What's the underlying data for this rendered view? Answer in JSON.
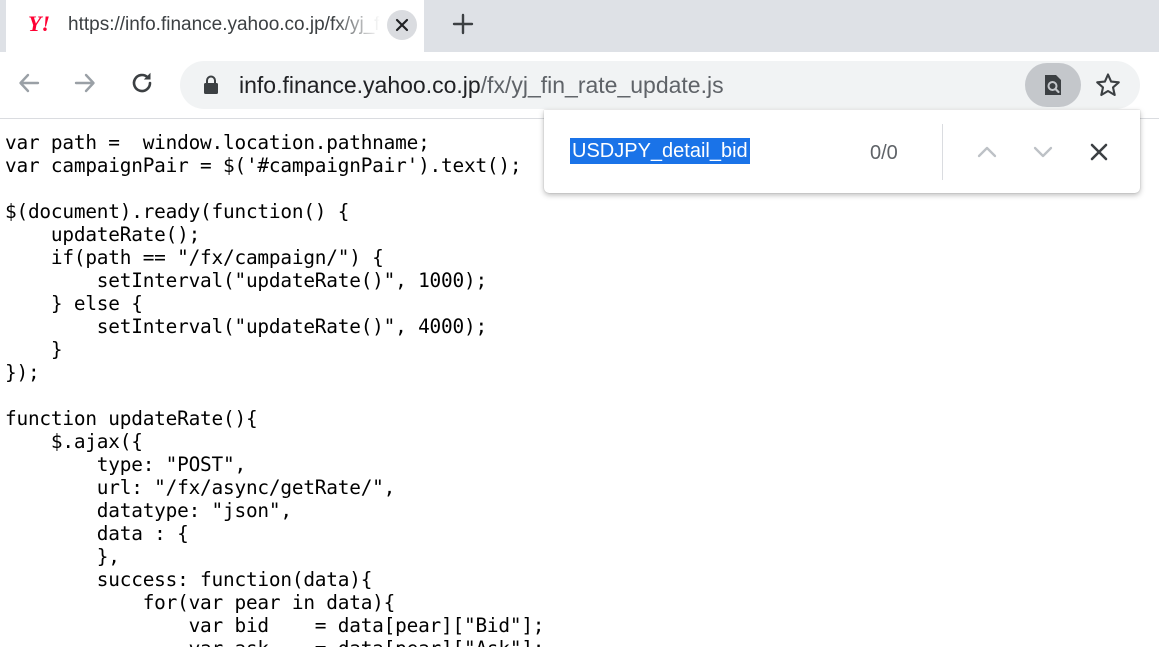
{
  "tab": {
    "favicon": "Y!",
    "title": "https://info.finance.yahoo.co.jp/fx/yj_fin_rate_update.js",
    "close_icon": "close-icon"
  },
  "toolbar": {
    "back_icon": "back-arrow-icon",
    "forward_icon": "forward-arrow-icon",
    "reload_icon": "reload-icon",
    "new_tab_icon": "plus-icon"
  },
  "omnibox": {
    "url_host": "info.finance.yahoo.co.jp",
    "url_path": "/fx/yj_fin_rate_update.js",
    "lock_icon": "lock-icon",
    "find_icon": "find-in-page-icon",
    "bookmark_icon": "star-icon"
  },
  "findbar": {
    "query": "USDJPY_detail_bid",
    "count": "0/0",
    "prev_icon": "chevron-up-icon",
    "next_icon": "chevron-down-icon",
    "close_icon": "close-icon"
  },
  "code_lines": [
    "var path =  window.location.pathname;",
    "var campaignPair = $('#campaignPair').text();",
    "",
    "$(document).ready(function() {",
    "    updateRate();",
    "    if(path == \"/fx/campaign/\") {",
    "        setInterval(\"updateRate()\", 1000);",
    "    } else {",
    "        setInterval(\"updateRate()\", 4000);",
    "    }",
    "});",
    "",
    "function updateRate(){",
    "    $.ajax({",
    "        type: \"POST\",",
    "        url: \"/fx/async/getRate/\",",
    "        datatype: \"json\",",
    "        data : {",
    "        },",
    "        success: function(data){",
    "            for(var pear in data){",
    "                var bid    = data[pear][\"Bid\"];",
    "                var ask    = data[pear][\"Ask\"];"
  ],
  "colors": {
    "tabstrip": "#dee1e6",
    "omnibox": "#f1f3f4",
    "selection": "#1a73e8",
    "favicon": "#ff0033"
  }
}
